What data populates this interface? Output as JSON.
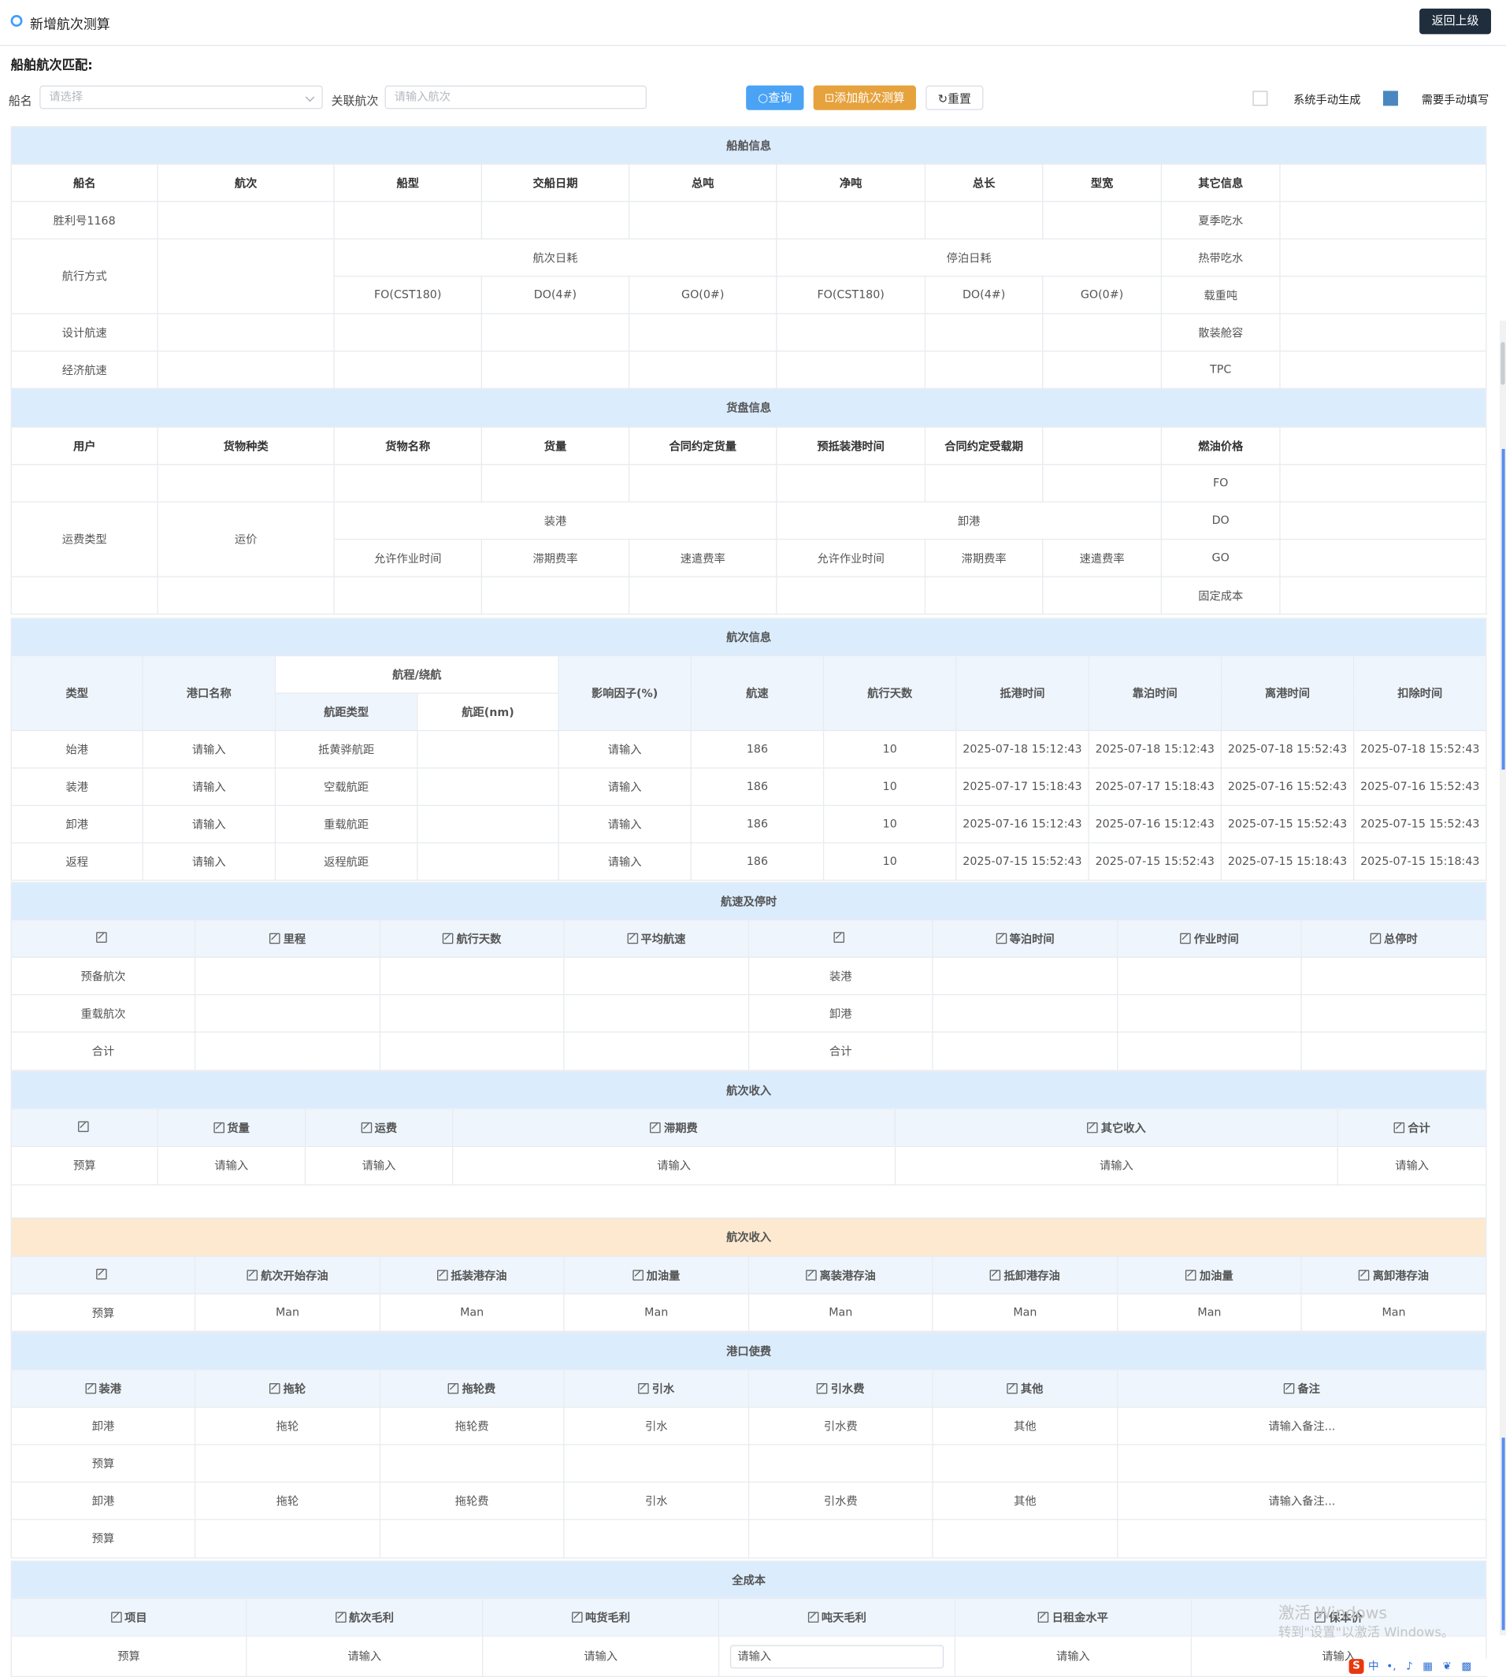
{
  "header": {
    "title": "新增航次测算",
    "back_label": "返回上级"
  },
  "search": {
    "section_label": "船舶航次匹配:",
    "ship_label": "船名",
    "ship_placeholder": "请选择",
    "voyage_label": "关联航次",
    "voyage_placeholder": "请输入航次",
    "query_label": "查询",
    "add_label": "添加航次测算",
    "reset_label": "重置"
  },
  "legend": {
    "auto_label": "系统手动生成",
    "manual_label": "需要手动填写",
    "manual_color": "#4a87c0"
  },
  "ship_info": {
    "title": "船舶信息",
    "headers": [
      "船名",
      "航次",
      "船型",
      "交船日期",
      "总吨",
      "净吨",
      "总长",
      "型宽",
      "其它信息"
    ],
    "ship_name": "胜利号1168",
    "other_labels": [
      "夏季吃水",
      "热带吃水",
      "载重吨",
      "散装舱容",
      "TPC"
    ],
    "nav_mode": "航行方式",
    "voyage_daily": "航次日耗",
    "berth_daily": "停泊日耗",
    "fuels": [
      "FO(CST180)",
      "DO(4#)",
      "GO(0#)",
      "FO(CST180)",
      "DO(4#)",
      "GO(0#)"
    ],
    "design_speed": "设计航速",
    "eco_speed": "经济航速"
  },
  "cargo_info": {
    "title": "货盘信息",
    "headers": [
      "用户",
      "货物种类",
      "货物名称",
      "货量",
      "合同约定货量",
      "预抵装港时间",
      "合同约定受载期",
      "",
      "燃油价格"
    ],
    "fuel_labels": [
      "FO",
      "DO",
      "GO",
      "固定成本"
    ],
    "freight_type": "运费类型",
    "freight": "运价",
    "load_port": "装港",
    "discharge_port": "卸港",
    "rate_headers": [
      "允许作业时间",
      "滞期费率",
      "速遣费率",
      "允许作业时间",
      "滞期费率",
      "速遣费率"
    ]
  },
  "voyage_info": {
    "title": "航次信息",
    "h_type": "类型",
    "h_port": "港口名称",
    "h_route": "航程/绕航",
    "h_dist_type": "航距类型",
    "h_dist": "航距(nm)",
    "h_factor": "影响因子(%)",
    "h_speed": "航速",
    "h_days": "航行天数",
    "h_arrive": "抵港时间",
    "h_berth": "靠泊时间",
    "h_depart": "离港时间",
    "h_deduct": "扣除时间",
    "rows": [
      {
        "type": "始港",
        "port": "请输入",
        "dist_type": "抵黄骅航距",
        "factor": "请输入",
        "speed": "186",
        "days": "10",
        "arrive": "2025-07-18 15:12:43",
        "berth": "2025-07-18 15:12:43",
        "depart": "2025-07-18 15:52:43",
        "deduct": "2025-07-18 15:52:43"
      },
      {
        "type": "装港",
        "port": "请输入",
        "dist_type": "空载航距",
        "factor": "请输入",
        "speed": "186",
        "days": "10",
        "arrive": "2025-07-17 15:18:43",
        "berth": "2025-07-17 15:18:43",
        "depart": "2025-07-16 15:52:43",
        "deduct": "2025-07-16 15:52:43"
      },
      {
        "type": "卸港",
        "port": "请输入",
        "dist_type": "重载航距",
        "factor": "请输入",
        "speed": "186",
        "days": "10",
        "arrive": "2025-07-16 15:12:43",
        "berth": "2025-07-16 15:12:43",
        "depart": "2025-07-15 15:52:43",
        "deduct": "2025-07-15 15:52:43"
      },
      {
        "type": "返程",
        "port": "请输入",
        "dist_type": "返程航距",
        "factor": "请输入",
        "speed": "186",
        "days": "10",
        "arrive": "2025-07-15 15:52:43",
        "berth": "2025-07-15 15:52:43",
        "depart": "2025-07-15 15:18:43",
        "deduct": "2025-07-15 15:18:43"
      }
    ]
  },
  "speed_stop": {
    "title": "航速及停时",
    "headers": [
      "",
      "里程",
      "航行天数",
      "平均航速",
      "",
      "等泊时间",
      "作业时间",
      "总停时"
    ],
    "left_rows": [
      "预备航次",
      "重载航次",
      "合计"
    ],
    "right_rows": [
      "装港",
      "卸港",
      "合计"
    ]
  },
  "income": {
    "title": "航次收入",
    "headers": [
      "",
      "货量",
      "运费",
      "滞期费",
      "其它收入",
      "合计"
    ],
    "row_label": "预算",
    "cells": [
      "请输入",
      "请输入",
      "请输入",
      "请输入",
      "请输入"
    ]
  },
  "fuel_section": {
    "title": "航次收入",
    "headers": [
      "",
      "航次开始存油",
      "抵装港存油",
      "加油量",
      "离装港存油",
      "抵卸港存油",
      "加油量",
      "离卸港存油"
    ],
    "row_label": "预算",
    "cells": [
      "Man",
      "Man",
      "Man",
      "Man",
      "Man",
      "Man",
      "Man"
    ]
  },
  "port_fee": {
    "title": "港口使费",
    "headers": [
      "装港",
      "拖轮",
      "拖轮费",
      "引水",
      "引水费",
      "其他",
      "备注"
    ],
    "rows": [
      [
        "卸港",
        "拖轮",
        "拖轮费",
        "引水",
        "引水费",
        "其他",
        "请输入备注..."
      ],
      [
        "预算",
        "",
        "",
        "",
        "",
        "",
        ""
      ],
      [
        "卸港",
        "拖轮",
        "拖轮费",
        "引水",
        "引水费",
        "其他",
        "请输入备注..."
      ],
      [
        "预算",
        "",
        "",
        "",
        "",
        "",
        ""
      ]
    ]
  },
  "total_cost": {
    "title": "全成本",
    "headers": [
      "项目",
      "航次毛利",
      "吨货毛利",
      "吨天毛利",
      "日租金水平",
      "保本价"
    ],
    "row_label": "预算",
    "cells": [
      "请输入",
      "请输入",
      "请输入",
      "请输入",
      "请输入"
    ]
  },
  "watermark": {
    "line1": "激活 Windows",
    "line2": "转到\"设置\"以激活 Windows。"
  },
  "tray": {
    "ime_logo": "S",
    "ime_mode": "中",
    "punct": "•,"
  }
}
